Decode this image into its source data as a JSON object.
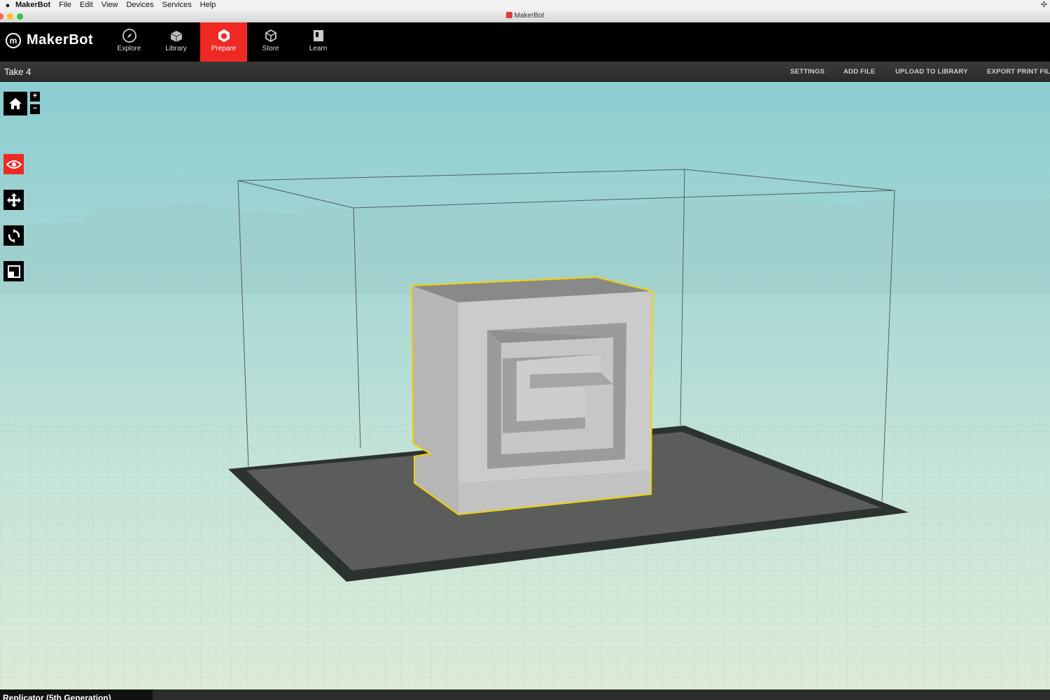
{
  "menubar": {
    "app": "MakerBot",
    "items": [
      "File",
      "Edit",
      "View",
      "Devices",
      "Services",
      "Help"
    ]
  },
  "window": {
    "title": "MakerBot"
  },
  "brand": {
    "logo_text": "MakerBot",
    "accent": "#ef2a24"
  },
  "nav": {
    "items": [
      {
        "label": "Explore",
        "icon": "compass-icon"
      },
      {
        "label": "Library",
        "icon": "library-icon"
      },
      {
        "label": "Prepare",
        "icon": "prepare-icon",
        "active": true
      },
      {
        "label": "Store",
        "icon": "cube-icon"
      },
      {
        "label": "Learn",
        "icon": "book-icon"
      }
    ]
  },
  "project": {
    "title": "Take 4",
    "actions": [
      "SETTINGS",
      "ADD FILE",
      "UPLOAD TO LIBRARY",
      "EXPORT PRINT FIL"
    ]
  },
  "tools": {
    "home": "home-icon",
    "zoom_in": "+",
    "zoom_out": "−",
    "view": "eye-icon",
    "move": "move-icon",
    "rotate": "rotate-icon",
    "scale": "scale-icon"
  },
  "bottom": {
    "printer": "Replicator (5th Generation)"
  }
}
